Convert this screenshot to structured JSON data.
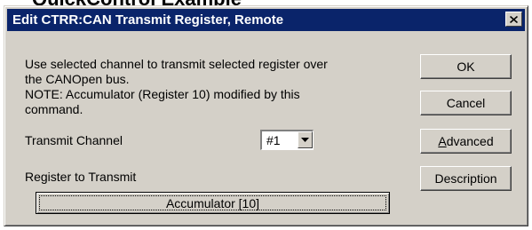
{
  "page_heading": "QuickControl Example",
  "window": {
    "title": "Edit CTRR:CAN Transmit Register, Remote",
    "close_symbol": "✕"
  },
  "description_lines": [
    "Use selected channel to transmit selected register over",
    "the CANOpen bus.",
    "NOTE:  Accumulator (Register 10) modified by this",
    "command."
  ],
  "transmit_channel": {
    "label": "Transmit Channel",
    "selected_value": "#1"
  },
  "register": {
    "label": "Register to Transmit",
    "button_label": "Accumulator [10]"
  },
  "buttons": {
    "ok": "OK",
    "cancel": "Cancel",
    "advanced_first": "A",
    "advanced_rest": "dvanced",
    "description": "Description"
  },
  "colors": {
    "titlebar": "#0a246a",
    "face": "#d4d0c8"
  },
  "icons": {
    "close": "close-icon",
    "dropdown": "chevron-down-icon"
  }
}
